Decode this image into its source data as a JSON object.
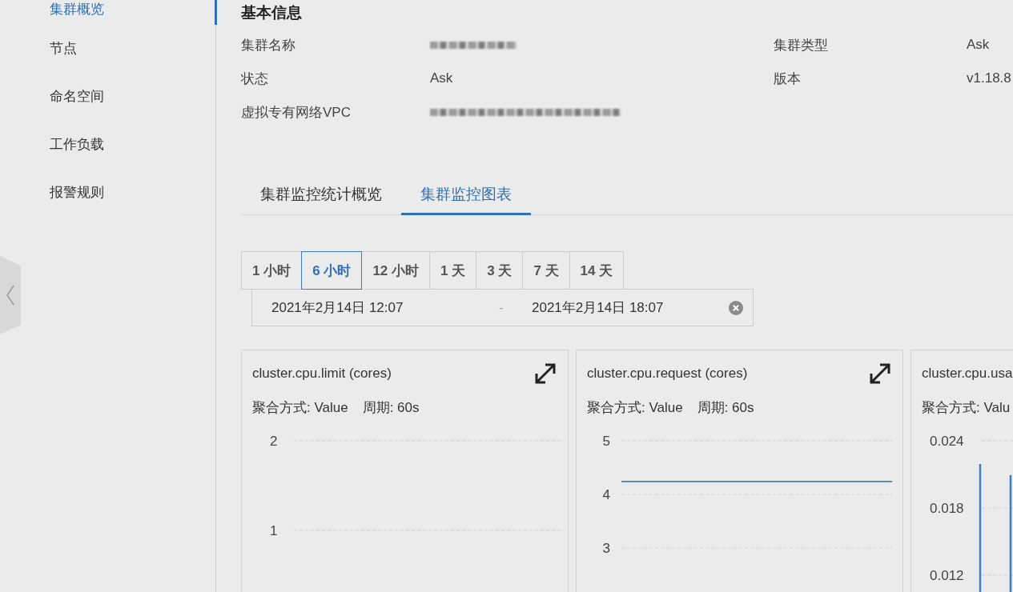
{
  "sidebar": {
    "items": [
      {
        "label": "集群概览",
        "selected": true
      },
      {
        "label": "节点",
        "selected": false
      },
      {
        "label": "命名空间",
        "selected": false
      },
      {
        "label": "工作负载",
        "selected": false
      },
      {
        "label": "报警规则",
        "selected": false
      }
    ]
  },
  "basic_info": {
    "title": "基本信息",
    "fields": [
      {
        "label": "集群名称",
        "redacted": true
      },
      {
        "label": "集群类型",
        "value": "Ask"
      },
      {
        "label": "状态",
        "value": "Ask"
      },
      {
        "label": "版本",
        "value": "v1.18.8"
      },
      {
        "label": "虚拟专有网络VPC",
        "redacted": true
      }
    ]
  },
  "tabs": [
    {
      "label": "集群监控统计概览",
      "selected": false
    },
    {
      "label": "集群监控图表",
      "selected": true
    }
  ],
  "time_range": {
    "options": [
      {
        "label": "1 小时",
        "selected": false
      },
      {
        "label": "6 小时",
        "selected": true
      },
      {
        "label": "12 小时",
        "selected": false
      },
      {
        "label": "1 天",
        "selected": false
      },
      {
        "label": "3 天",
        "selected": false
      },
      {
        "label": "7 天",
        "selected": false
      },
      {
        "label": "14 天",
        "selected": false
      }
    ],
    "start": "2021年2月14日 12:07",
    "separator": "-",
    "end": "2021年2月14日 18:07"
  },
  "charts": [
    {
      "title": "cluster.cpu.limit (cores)",
      "aggregation": "聚合方式: Value",
      "period": "周期: 60s",
      "expandable": true,
      "kind": "empty",
      "grid_labels": [
        "2",
        "1"
      ]
    },
    {
      "title": "cluster.cpu.request (cores)",
      "aggregation": "聚合方式: Value",
      "period": "周期: 60s",
      "expandable": true,
      "kind": "line",
      "chart_data": {
        "type": "line",
        "ylim": [
          3,
          5
        ],
        "yticks": [
          3,
          4,
          5
        ],
        "series": [
          {
            "color": "#3d7fc4",
            "values": [
              4.24,
              4.24,
              4.24,
              4.24,
              4.24,
              4.24,
              4.24,
              4.24,
              4.24,
              4.24,
              4.24,
              4.24,
              4.24,
              4.24,
              4.24,
              4.24,
              4.24,
              4.24,
              4.24,
              4.24
            ]
          }
        ]
      }
    },
    {
      "title": "cluster.cpu.usa",
      "aggregation": "聚合方式: Valu",
      "expandable": false,
      "kind": "spikes",
      "grid_labels": [
        "0.024",
        "0.018",
        "0.012"
      ]
    }
  ]
}
